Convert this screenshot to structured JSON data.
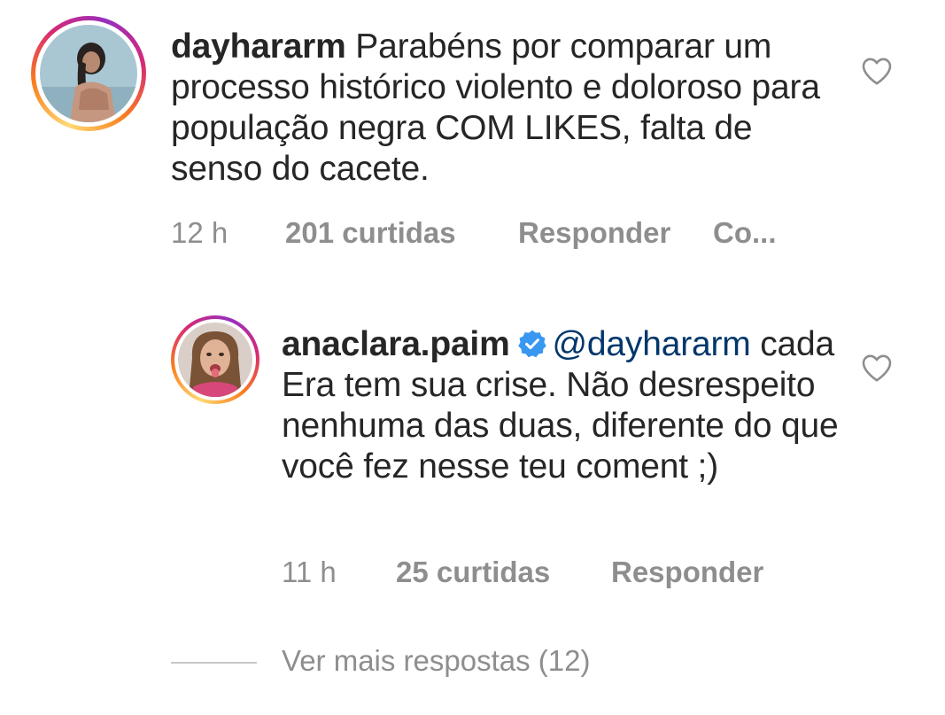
{
  "comments": [
    {
      "username": "dayhararm",
      "text": "Parabéns por comparar um processo histórico violento e doloroso para população negra COM LIKES, falta de senso do cacete.",
      "time": "12 h",
      "likes": "201 curtidas",
      "reply_label": "Responder",
      "more_label": "Co..."
    },
    {
      "username": "anaclara.paim",
      "verified": true,
      "mention": "@dayhararm",
      "text": "cada Era tem sua crise. Não desrespeito nenhuma das duas, diferente do que você fez nesse teu coment ;)",
      "time": "11 h",
      "likes": "25 curtidas",
      "reply_label": "Responder"
    }
  ],
  "view_more_replies": "Ver mais respostas (12)",
  "icons": {
    "like": "heart-outline-icon",
    "verified": "verified-badge-icon"
  },
  "colors": {
    "text": "#262626",
    "secondary": "#8e8e8e",
    "mention": "#00376b",
    "verified": "#3897f0"
  }
}
